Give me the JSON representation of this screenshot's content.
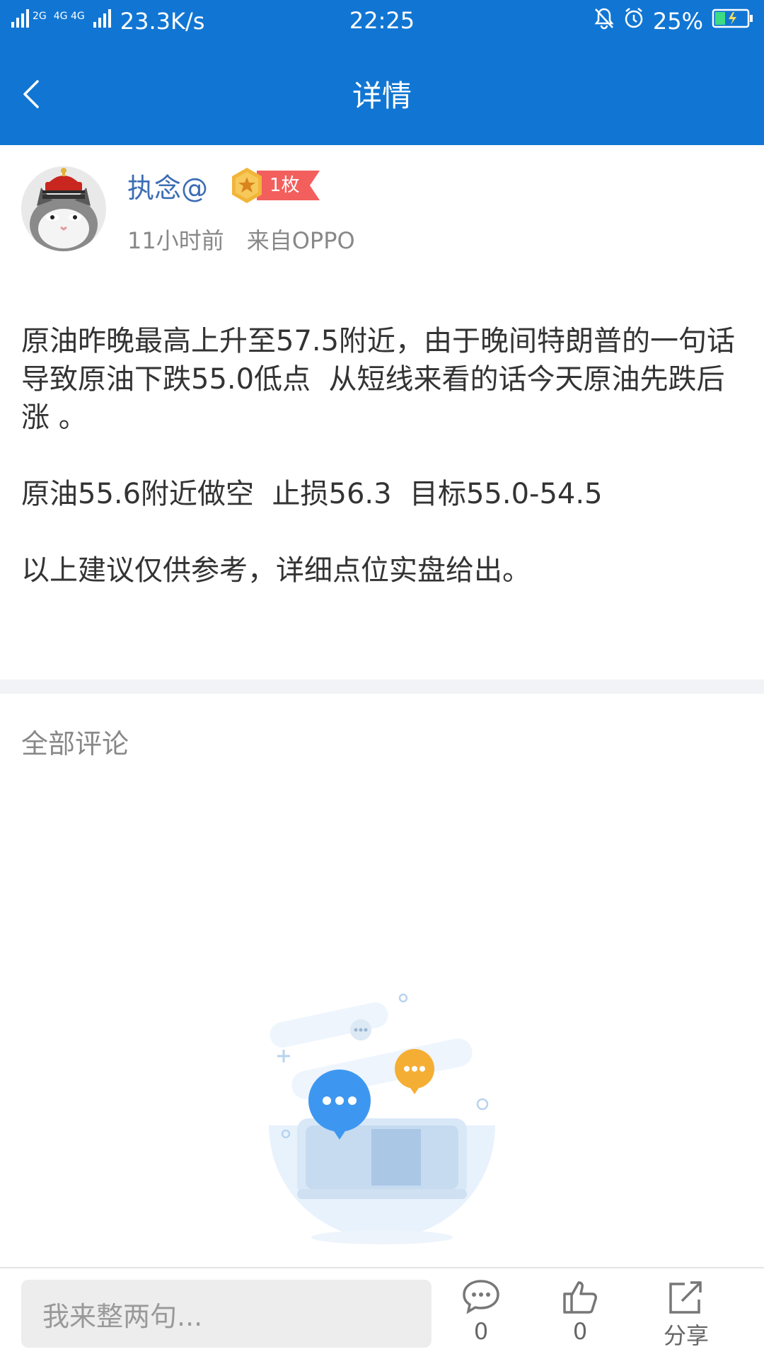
{
  "status_bar": {
    "network_left": "2G",
    "network_right": "4G 4G",
    "speed": "23.3K/s",
    "time": "22:25",
    "battery_percent": "25%"
  },
  "nav": {
    "title": "详情"
  },
  "author": {
    "name": "执念@",
    "medal_count": "1枚",
    "time_ago": "11小时前",
    "source": "来自OPPO"
  },
  "post": {
    "paragraphs": [
      "原油昨晚最高上升至57.5附近，由于晚间特朗普的一句话导致原油下跌55.0低点  从短线来看的话今天原油先跌后涨 。",
      "原油55.6附近做空  止损56.3  目标55.0-54.5",
      "以上建议仅供参考，详细点位实盘给出。"
    ]
  },
  "comments": {
    "section_title": "全部评论"
  },
  "bottom_bar": {
    "input_placeholder": "我来整两句...",
    "comment_count": "0",
    "like_count": "0",
    "share_label": "分享"
  },
  "colors": {
    "header_bg": "#1176d3",
    "author_name": "#3b6db5",
    "medal_badge": "#f25f5c"
  },
  "icons": [
    "back-chevron-icon",
    "bell-off-icon",
    "alarm-icon",
    "battery-icon",
    "medal-icon",
    "comment-icon",
    "like-icon",
    "share-icon"
  ]
}
